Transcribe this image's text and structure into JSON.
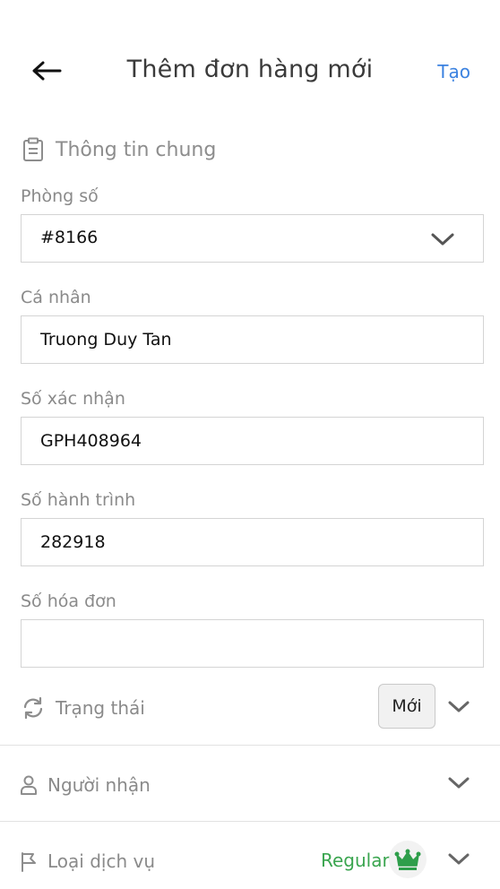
{
  "header": {
    "title": "Thêm đơn hàng mới",
    "create_label": "Tạo"
  },
  "section": {
    "title": "Thông tin chung"
  },
  "fields": {
    "room": {
      "label": "Phòng số",
      "value": "#8166"
    },
    "individual": {
      "label": "Cá nhân",
      "value": "Truong Duy Tan"
    },
    "confirmation": {
      "label": "Số xác nhận",
      "value": "GPH408964"
    },
    "itinerary": {
      "label": "Số hành trình",
      "value": "282918"
    },
    "invoice": {
      "label": "Số hóa đơn",
      "value": ""
    }
  },
  "status": {
    "label": "Trạng thái",
    "value": "Mới"
  },
  "recipient": {
    "label": "Người nhận"
  },
  "service": {
    "label": "Loại dịch vụ",
    "value": "Regular"
  },
  "colors": {
    "accent": "#3b82e0",
    "badge_green": "#3aa54f",
    "label_gray": "#8a8a8a",
    "border": "#d4d4d4"
  },
  "icons": [
    "back-arrow-icon",
    "clipboard-icon",
    "chevron-down-icon",
    "sync-icon",
    "person-icon",
    "flag-icon",
    "crown-icon"
  ]
}
